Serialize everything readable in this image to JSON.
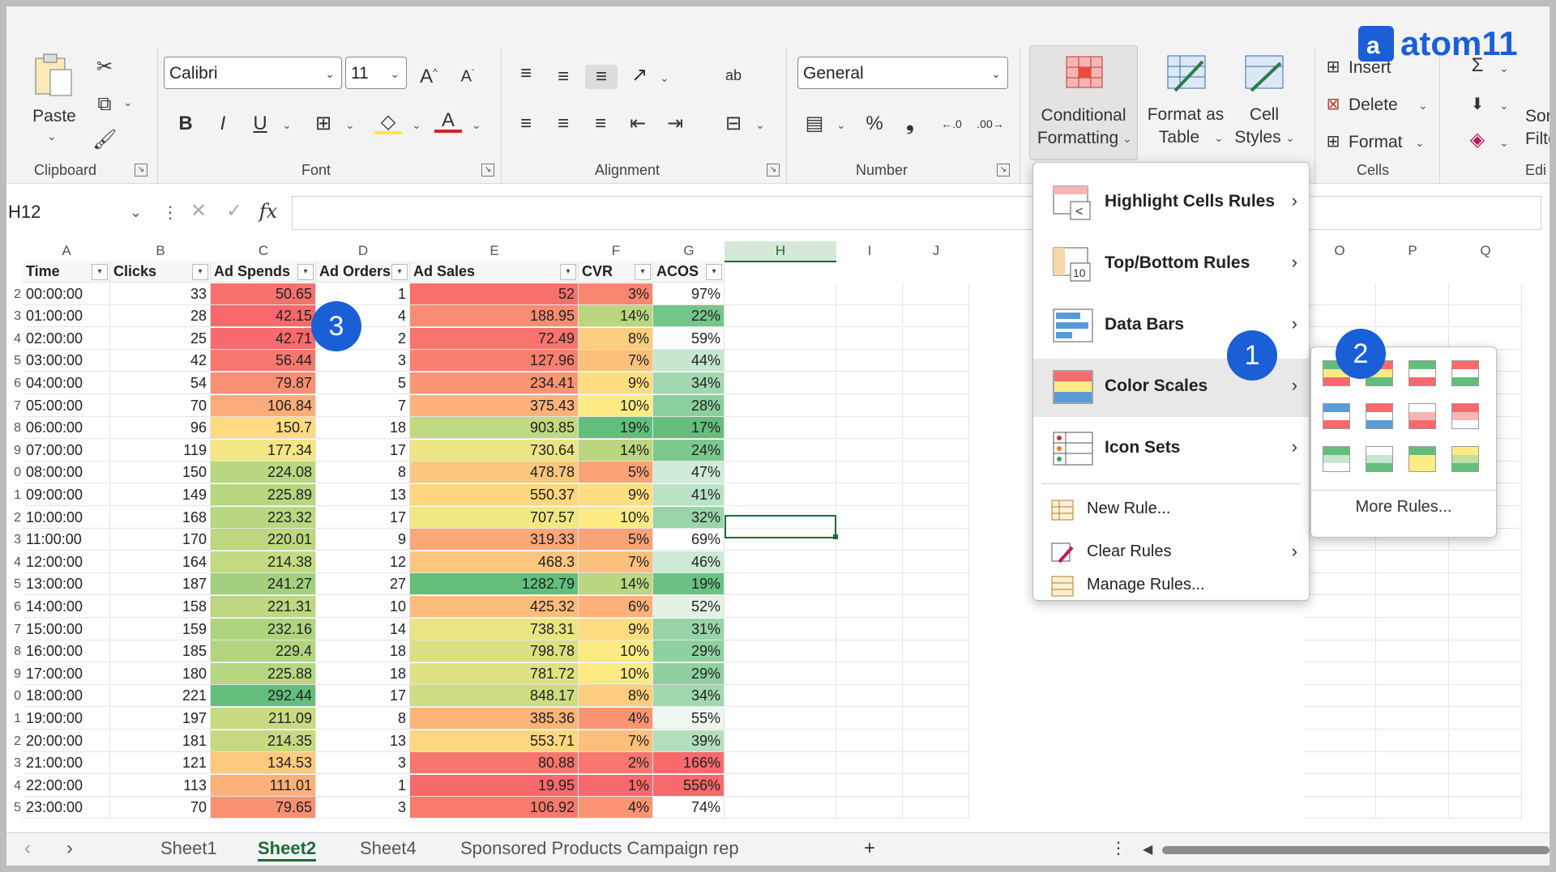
{
  "ribbon": {
    "clipboard": {
      "paste": "Paste",
      "label": "Clipboard"
    },
    "font": {
      "family": "Calibri",
      "size": "11",
      "label": "Font"
    },
    "alignment": {
      "label": "Alignment"
    },
    "number": {
      "format": "General",
      "label": "Number"
    },
    "styles": {
      "conditional_formatting": "Conditional",
      "conditional_formatting_2": "Formatting",
      "format_as_table": "Format as",
      "format_as_table_2": "Table",
      "cell_styles": "Cell",
      "cell_styles_2": "Styles"
    },
    "cells": {
      "insert": "Insert",
      "delete": "Delete",
      "format": "Format",
      "label": "Cells"
    },
    "editing": {
      "sort": "Sor",
      "filter": "Filte",
      "label": "Edi"
    }
  },
  "logo": {
    "text": "atom11"
  },
  "formula_bar": {
    "name_box": "H12",
    "fx": "fx"
  },
  "columns": [
    "A",
    "B",
    "C",
    "D",
    "E",
    "F",
    "G",
    "H",
    "I",
    "J",
    "O",
    "P",
    "Q"
  ],
  "headers": [
    "Time",
    "Clicks",
    "Ad Spends",
    "Ad Orders",
    "Ad Sales",
    "CVR",
    "ACOS"
  ],
  "row_numbers": [
    "2",
    "3",
    "4",
    "5",
    "6",
    "7",
    "8",
    "9",
    "0",
    "1",
    "2",
    "3",
    "4",
    "5",
    "6",
    "7",
    "8",
    "9",
    "0",
    "1",
    "2",
    "3",
    "4",
    "5"
  ],
  "rows": [
    [
      "00:00:00",
      "33",
      "50.65",
      "1",
      "52",
      "3%",
      "97%"
    ],
    [
      "01:00:00",
      "28",
      "42.15",
      "4",
      "188.95",
      "14%",
      "22%"
    ],
    [
      "02:00:00",
      "25",
      "42.71",
      "2",
      "72.49",
      "8%",
      "59%"
    ],
    [
      "03:00:00",
      "42",
      "56.44",
      "3",
      "127.96",
      "7%",
      "44%"
    ],
    [
      "04:00:00",
      "54",
      "79.87",
      "5",
      "234.41",
      "9%",
      "34%"
    ],
    [
      "05:00:00",
      "70",
      "106.84",
      "7",
      "375.43",
      "10%",
      "28%"
    ],
    [
      "06:00:00",
      "96",
      "150.7",
      "18",
      "903.85",
      "19%",
      "17%"
    ],
    [
      "07:00:00",
      "119",
      "177.34",
      "17",
      "730.64",
      "14%",
      "24%"
    ],
    [
      "08:00:00",
      "150",
      "224.08",
      "8",
      "478.78",
      "5%",
      "47%"
    ],
    [
      "09:00:00",
      "149",
      "225.89",
      "13",
      "550.37",
      "9%",
      "41%"
    ],
    [
      "10:00:00",
      "168",
      "223.32",
      "17",
      "707.57",
      "10%",
      "32%"
    ],
    [
      "11:00:00",
      "170",
      "220.01",
      "9",
      "319.33",
      "5%",
      "69%"
    ],
    [
      "12:00:00",
      "164",
      "214.38",
      "12",
      "468.3",
      "7%",
      "46%"
    ],
    [
      "13:00:00",
      "187",
      "241.27",
      "27",
      "1282.79",
      "14%",
      "19%"
    ],
    [
      "14:00:00",
      "158",
      "221.31",
      "10",
      "425.32",
      "6%",
      "52%"
    ],
    [
      "15:00:00",
      "159",
      "232.16",
      "14",
      "738.31",
      "9%",
      "31%"
    ],
    [
      "16:00:00",
      "185",
      "229.4",
      "18",
      "798.78",
      "10%",
      "29%"
    ],
    [
      "17:00:00",
      "180",
      "225.88",
      "18",
      "781.72",
      "10%",
      "29%"
    ],
    [
      "18:00:00",
      "221",
      "292.44",
      "17",
      "848.17",
      "8%",
      "34%"
    ],
    [
      "19:00:00",
      "197",
      "211.09",
      "8",
      "385.36",
      "4%",
      "55%"
    ],
    [
      "20:00:00",
      "181",
      "214.35",
      "13",
      "553.71",
      "7%",
      "39%"
    ],
    [
      "21:00:00",
      "121",
      "134.53",
      "3",
      "80.88",
      "2%",
      "166%"
    ],
    [
      "22:00:00",
      "113",
      "111.01",
      "1",
      "19.95",
      "1%",
      "556%"
    ],
    [
      "23:00:00",
      "70",
      "79.65",
      "3",
      "106.92",
      "4%",
      "74%"
    ]
  ],
  "colors": {
    "accent": "#1d6b3a",
    "badge": "#1a5fd6",
    "scale_red": "#f8696b",
    "scale_yellow": "#ffeb84",
    "scale_green": "#63be7b"
  },
  "menu": {
    "items": [
      {
        "label": "Highlight Cells Rules",
        "icon": "highlight-cells-icon"
      },
      {
        "label": "Top/Bottom Rules",
        "icon": "top-bottom-icon"
      },
      {
        "label": "Data Bars",
        "icon": "data-bars-icon"
      },
      {
        "label": "Color Scales",
        "icon": "color-scales-icon"
      },
      {
        "label": "Icon Sets",
        "icon": "icon-sets-icon"
      }
    ],
    "new_rule": "New Rule...",
    "clear_rules": "Clear Rules",
    "manage_rules": "Manage Rules..."
  },
  "submenu": {
    "more_rules": "More Rules..."
  },
  "badges": [
    "1",
    "2",
    "3"
  ],
  "sheet_tabs": [
    "Sheet1",
    "Sheet2",
    "Sheet4",
    "Sponsored Products Campaign rep"
  ],
  "active_tab": "Sheet2"
}
